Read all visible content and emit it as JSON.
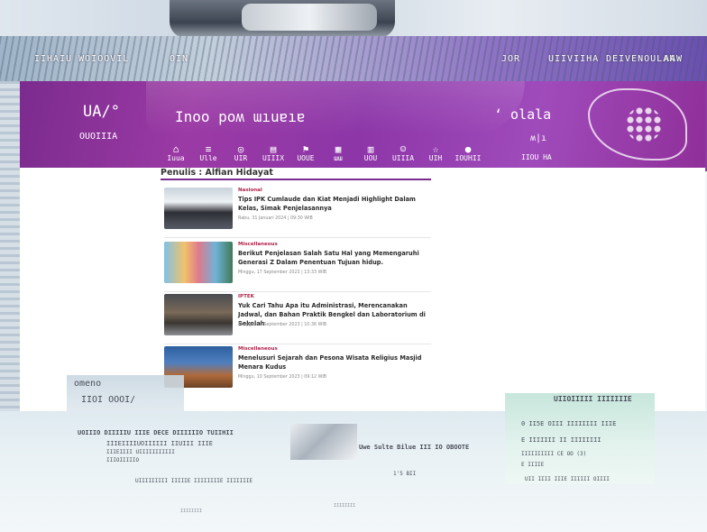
{
  "colors": {
    "brand_purple": "#8c36a8",
    "accent_line": "#7b2b8e",
    "category_label": "#b0234a",
    "footer_bg": "#eaf2f5"
  },
  "top_nav": {
    "item1": "IIHAIU WOIOOVIL",
    "item2": "OIN",
    "item3": "JOR",
    "item4": "UIIVIIHA",
    "item5": "DEIVENOULAN",
    "item6": "AAW"
  },
  "header": {
    "logo_left": "UA/°",
    "logo_left_sub": "OUOIIIA",
    "logo_main": "Inoo poʍ ɯıuɐıɐ",
    "logo_right": "‘ olala",
    "logo_right_sub": "ʍ|ı",
    "logo_right_sub2": "IIOU HA"
  },
  "categories": [
    {
      "icon": "home-icon",
      "glyph": "⌂",
      "label": "Iuua"
    },
    {
      "icon": "news-icon",
      "glyph": "≡",
      "label": "Ulle"
    },
    {
      "icon": "globe-icon",
      "glyph": "◎",
      "label": "UIR"
    },
    {
      "icon": "book-icon",
      "glyph": "▤",
      "label": "UIIIX"
    },
    {
      "icon": "flag-icon",
      "glyph": "⚑",
      "label": "UOUE"
    },
    {
      "icon": "grid-icon",
      "glyph": "▦",
      "label": "ɯɯ"
    },
    {
      "icon": "chart-icon",
      "glyph": "▥",
      "label": "UOU"
    },
    {
      "icon": "people-icon",
      "glyph": "☺",
      "label": "UIIIA"
    },
    {
      "icon": "star-icon",
      "glyph": "☆",
      "label": "UIH"
    },
    {
      "icon": "drop-icon",
      "glyph": "●",
      "label": "IOUHII"
    }
  ],
  "author_page": {
    "heading": "Penulis : Alfian Hidayat"
  },
  "articles": [
    {
      "category": "Nasional",
      "title": "Tips IPK Cumlaude dan Kiat Menjadi Highlight Dalam Kelas, Simak Penjelasannya",
      "date": "Rabu, 31 Januari 2024 | 09:30 WIB"
    },
    {
      "category": "Miscellaneous",
      "title": "Berikut Penjelasan Salah Satu Hal yang Memengaruhi Generasi Z Dalam Penentuan Tujuan hidup.",
      "date": "Minggu, 17 September 2023 | 13:33 WIB"
    },
    {
      "category": "IPTEK",
      "title": "Yuk Cari Tahu Apa itu Administrasi, Merencanakan Jadwal, dan Bahan Praktik Bengkel dan Laboratorium di Sekolah",
      "date": "Minggu, 10 September 2023 | 10:36 WIB"
    },
    {
      "category": "Miscellaneous",
      "title": "Menelusuri Sejarah dan Pesona Wisata Religius Masjid Menara Kudus",
      "date": "Minggu, 10 September 2023 | 09:12 WIB"
    }
  ],
  "footer": {
    "left_title": "omeno",
    "left_sub": "IIOI OOOI/",
    "left_heading": "UOIIIO DIIIIIU IIIE DECE DIIIIIIO TUIIHII",
    "left_line1": "IIIEIIIIUOIIIIII  IIUIII IIIE",
    "left_line2": "IIIEIIII UIIIIIIIIIII",
    "left_line3": "IIIOIIIIIO",
    "left_bottom": "UIIIIIIIII IIIIIE IIIIIIIIE  IIIIIIIE",
    "mid_title": "Uwe Sulte Bilue III IO OBOOTE",
    "mid_sub": "1'5 BII",
    "right_title": "UIIOIIIII IIIIIIIE",
    "right_line1": "0  II5E  OIII IIIIIIII IIIE",
    "right_line2": "E  IIIIIII II IIIIIIII",
    "right_line3": "IIIIIIIIII CE OO  (3)",
    "right_line4": "E  IIIIE",
    "right_bottom": "UII IIII IIIE IIIIII OIIII",
    "copyright_a": "IIIIIIII",
    "copyright_b": "IIIIIIII"
  }
}
